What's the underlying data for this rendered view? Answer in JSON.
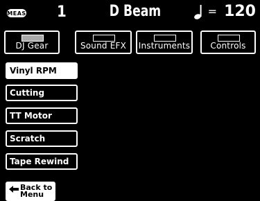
{
  "status": {
    "meas_badge": "MEAS",
    "measure": "1",
    "title": "D Beam",
    "tempo_eq": "=",
    "tempo": "120"
  },
  "tabs": [
    {
      "label": "DJ Gear",
      "active": true
    },
    {
      "label": "Sound EFX",
      "active": false
    },
    {
      "label": "Instruments",
      "active": false
    },
    {
      "label": "Controls",
      "active": false
    }
  ],
  "list": [
    {
      "label": "Vinyl RPM",
      "active": true
    },
    {
      "label": "Cutting",
      "active": false
    },
    {
      "label": "TT Motor",
      "active": false
    },
    {
      "label": "Scratch",
      "active": false
    },
    {
      "label": "Tape Rewind",
      "active": false
    }
  ],
  "back": {
    "line1": "Back to",
    "line2": "Menu",
    "icon": "left-arrow-icon"
  },
  "colors": {
    "background": "#000000",
    "foreground": "#ffffff"
  }
}
